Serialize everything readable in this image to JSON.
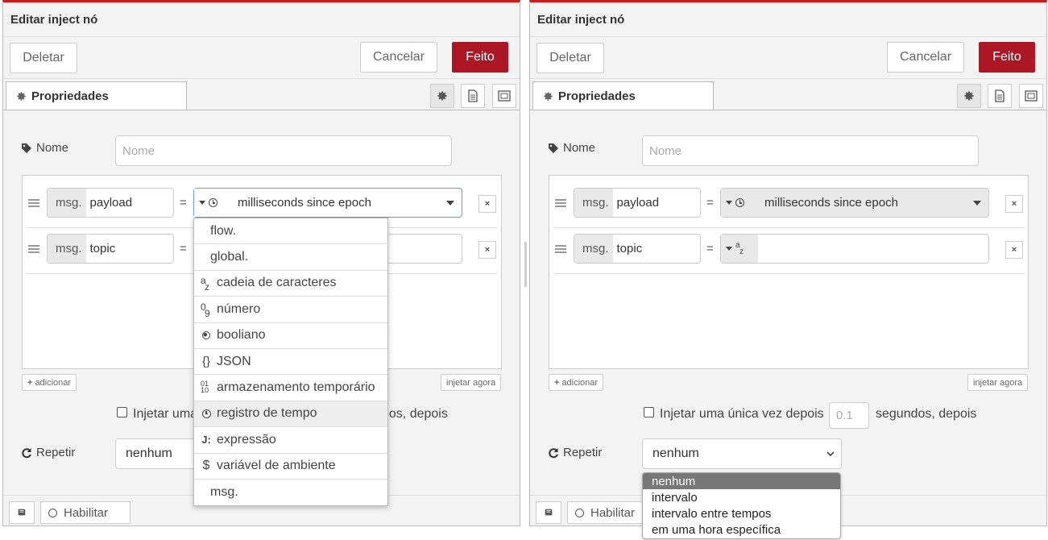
{
  "colors": {
    "accent_red": "#ad1625",
    "top_border": "#c02020",
    "panel_bg": "#f3f3f3",
    "selected_option_bg": "#777777"
  },
  "panel": {
    "title": "Editar inject nó",
    "delete_label": "Deletar",
    "cancel_label": "Cancelar",
    "done_label": "Feito",
    "tab_label": "Propriedades",
    "tab_icon": "gear-icon",
    "toolbar_icons": [
      "gear-icon",
      "document-icon",
      "frame-icon"
    ],
    "name_label": "Nome",
    "name_placeholder": "Nome",
    "msg_prefix": "msg.",
    "equals": "=",
    "rows": [
      {
        "property": "payload",
        "type_icon": "clock-icon",
        "value": "milliseconds since epoch"
      },
      {
        "property": "topic",
        "type_icon": "string-az-icon",
        "value": ""
      }
    ],
    "add_label": "adicionar",
    "inject_now_label": "injetar agora",
    "once_label": "Injetar uma única vez depois",
    "once_label_clipped_left": "Injetar uma",
    "once_label_tail_left": "dos, depois",
    "once_seconds_placeholder": "0.1",
    "once_seconds_suffix": "segundos, depois",
    "repeat_label": "Repetir",
    "repeat_value": "nenhum",
    "enable_label": "Habilitar",
    "az_sup": "a",
    "az_sub": "z"
  },
  "type_menu": {
    "items": [
      {
        "label": "flow.",
        "icon": ""
      },
      {
        "label": "global.",
        "icon": ""
      },
      {
        "label": "cadeia de caracteres",
        "icon": "string-az-icon"
      },
      {
        "label": "número",
        "icon": "number-09-icon"
      },
      {
        "label": "booliano",
        "icon": "boolean-icon"
      },
      {
        "label": "JSON",
        "icon": "json-braces-icon"
      },
      {
        "label": "armazenamento temporário",
        "icon": "binary-icon"
      },
      {
        "label": "registro de tempo",
        "icon": "clock-icon",
        "highlighted": true
      },
      {
        "label": "expressão",
        "icon": "expression-icon"
      },
      {
        "label": "variável de ambiente",
        "icon": "dollar-icon"
      },
      {
        "label": "msg.",
        "icon": ""
      }
    ]
  },
  "repeat_options": [
    "nenhum",
    "intervalo",
    "intervalo entre tempos",
    "em uma hora específica"
  ],
  "glyphs": {
    "braces": "{}",
    "binary_top": "01",
    "binary_bottom": "10",
    "num_top": "0",
    "num_bottom": "9",
    "jsonata": "J:",
    "dollar": "$",
    "x": "×"
  }
}
